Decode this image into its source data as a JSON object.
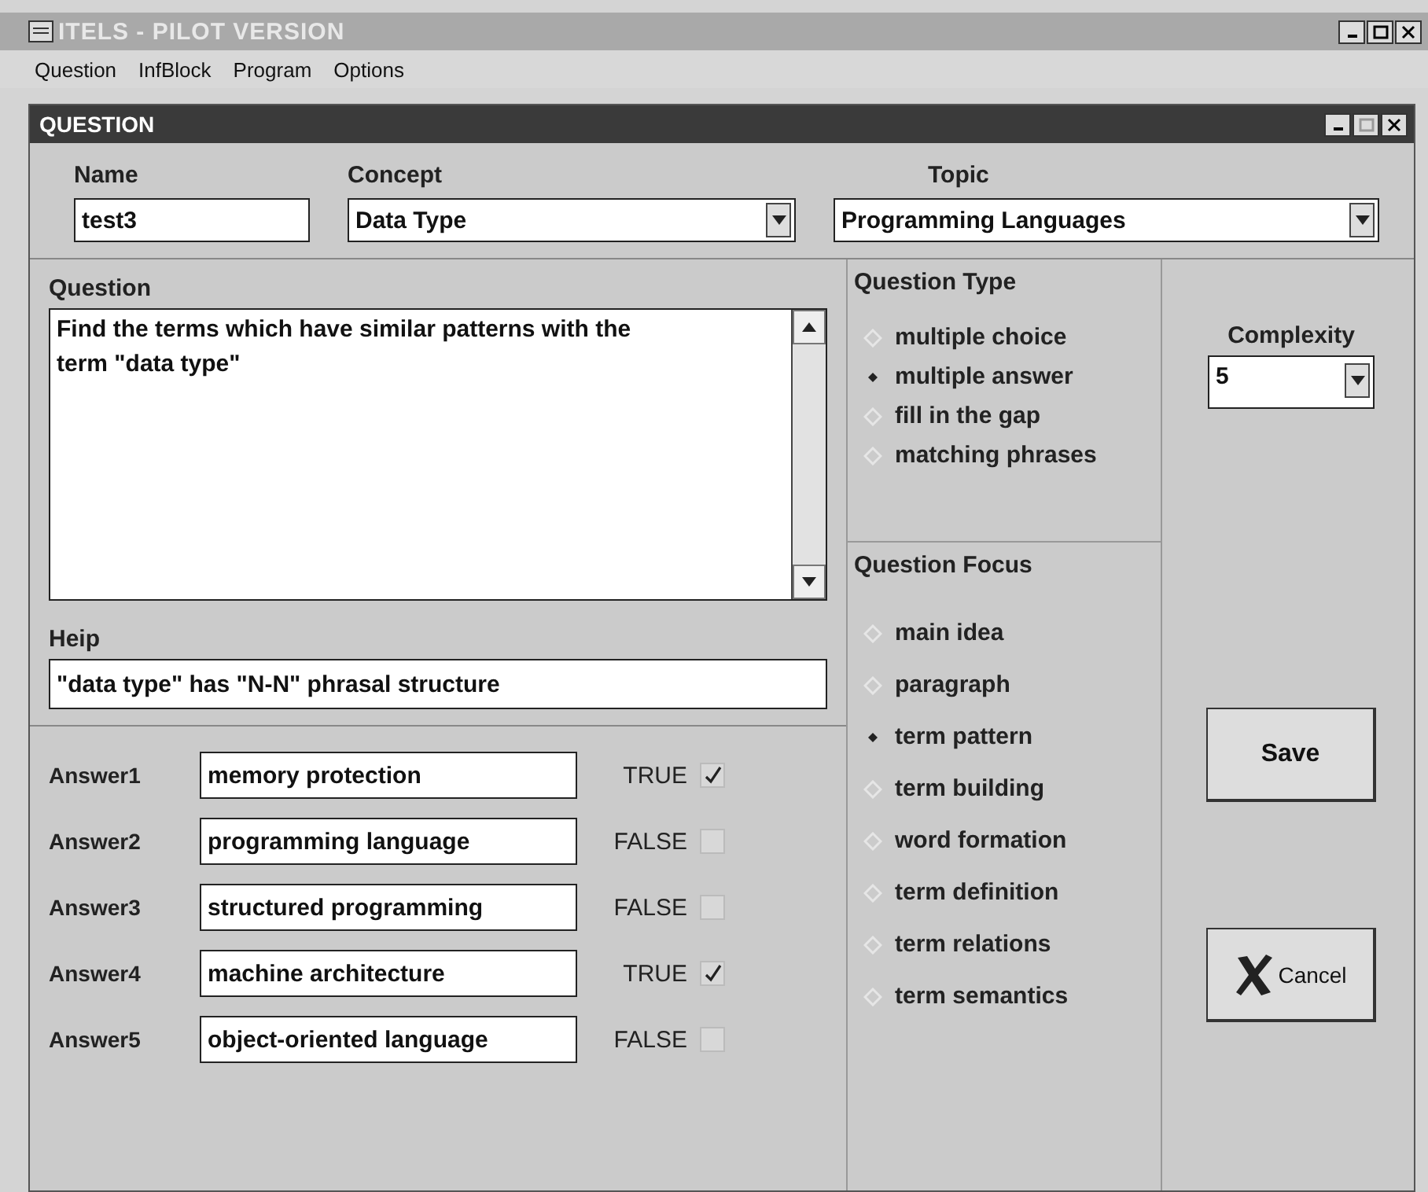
{
  "window": {
    "title": "ITELS - PILOT VERSION"
  },
  "menu": [
    "Question",
    "InfBlock",
    "Program",
    "Options"
  ],
  "dialog": {
    "title": "QUESTION"
  },
  "name": {
    "label": "Name",
    "value": "test3"
  },
  "concept": {
    "label": "Concept",
    "value": "Data Type"
  },
  "topic": {
    "label": "Topic",
    "value": "Programming Languages"
  },
  "question": {
    "label": "Question",
    "value": "Find the terms which have similar patterns with the term \"data type\""
  },
  "help": {
    "label": "Heip",
    "value": "\"data type\" has \"N-N\" phrasal structure"
  },
  "answers": [
    {
      "label": "Answer1",
      "value": "memory protection",
      "truth": "TRUE",
      "checked": true
    },
    {
      "label": "Answer2",
      "value": "programming language",
      "truth": "FALSE",
      "checked": false
    },
    {
      "label": "Answer3",
      "value": "structured programming",
      "truth": "FALSE",
      "checked": false
    },
    {
      "label": "Answer4",
      "value": "machine architecture",
      "truth": "TRUE",
      "checked": true
    },
    {
      "label": "Answer5",
      "value": "object-oriented language",
      "truth": "FALSE",
      "checked": false
    }
  ],
  "question_type": {
    "label": "Question Type",
    "options": [
      {
        "label": "multiple choice",
        "selected": false
      },
      {
        "label": "multiple answer",
        "selected": true
      },
      {
        "label": "fill in the gap",
        "selected": false
      },
      {
        "label": "matching phrases",
        "selected": false
      }
    ]
  },
  "question_focus": {
    "label": "Question Focus",
    "options": [
      {
        "label": "main idea",
        "selected": false
      },
      {
        "label": "paragraph",
        "selected": false
      },
      {
        "label": "term pattern",
        "selected": true
      },
      {
        "label": "term building",
        "selected": false
      },
      {
        "label": "word formation",
        "selected": false
      },
      {
        "label": "term definition",
        "selected": false
      },
      {
        "label": "term relations",
        "selected": false
      },
      {
        "label": "term semantics",
        "selected": false
      }
    ]
  },
  "complexity": {
    "label": "Complexity",
    "value": "5"
  },
  "buttons": [
    {
      "kind": "save",
      "label": "Save"
    },
    {
      "kind": "cancel",
      "label": "Cancel"
    }
  ]
}
